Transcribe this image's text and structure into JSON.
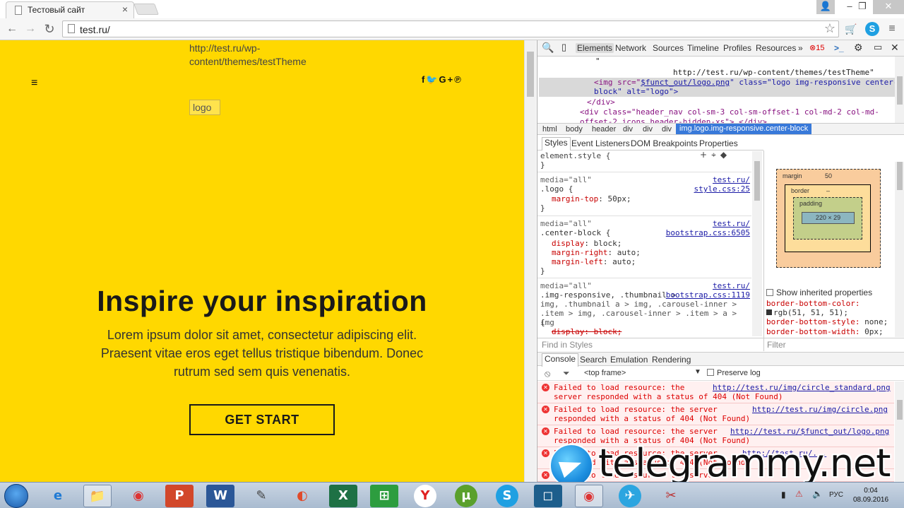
{
  "browser": {
    "tab_title": "Тестовый сайт",
    "tab_close": "×",
    "address": "test.ru/",
    "window_controls": {
      "minimize": "–",
      "maximize": "❐",
      "close": "✕"
    },
    "user_badge": "👤"
  },
  "page": {
    "theme_url": "http://test.ru/wp-content/themes/testTheme",
    "menu_icon": "≡",
    "social": "f🐦 G+ ℗",
    "logo_alt": "logo",
    "hero_title": "Inspire your inspiration",
    "hero_text": "Lorem ipsum dolor sit amet, consectetur adipiscing elit. Praesent vitae eros eget tellus tristique bibendum. Donec rutrum sed sem quis venenatis.",
    "hero_button": "GET START",
    "background_color": "#ffd800"
  },
  "devtools": {
    "tabs": [
      "Elements",
      "Network",
      "Sources",
      "Timeline",
      "Profiles",
      "Resources"
    ],
    "more": "»",
    "error_count": "15",
    "dom_lines": {
      "quote": "\"",
      "theme_text": "http://test.ru/wp-content/themes/testTheme\"",
      "img_open": "<img src=\"",
      "img_src": "$funct_out/logo.png",
      "img_rest": "\" class=\"logo img-responsive center-",
      "img_rest2": "block\" alt=\"logo\">",
      "div_close": "</div>",
      "div_next": "<div class=\"header_nav col-sm-3 col-sm-offset-1 col-md-2 col-md-",
      "div_next2": "offset-2 icons header-hidden-xs\">…</div>"
    },
    "breadcrumbs": [
      "html",
      "body",
      "header",
      "div",
      "div",
      "div",
      "img.logo.img-responsive.center-block"
    ],
    "styles_tabs": [
      "Styles",
      "Event Listeners",
      "DOM Breakpoints",
      "Properties"
    ],
    "rules": {
      "element_style": "element.style {",
      "close": "}",
      "media": "media=\"all\"",
      "r1_src_a": "test.ru/",
      "r1_src_b": "style.css:25",
      "r1_sel": ".logo {",
      "r1_p1": "margin-top",
      "r1_v1": ": 50px;",
      "r2_src_a": "test.ru/",
      "r2_src_b": "bootstrap.css:6505",
      "r2_sel": ".center-block {",
      "r2_p1": "display",
      "r2_v1": ": block;",
      "r2_p2": "margin-right",
      "r2_v2": ": auto;",
      "r2_p3": "margin-left",
      "r2_v3": ": auto;",
      "r3_src_a": "test.ru/",
      "r3_src_b": "bootstrap.css:1119",
      "r3_sel1": ".img-responsive, .thumbnail >",
      "r3_sel2": "img, .thumbnail a > img, .carousel-inner >",
      "r3_sel3": ".item > img, .carousel-inner > .item > a > img",
      "r3_brace": "{",
      "r3_p1": "display: block;"
    },
    "find_styles": "Find in Styles",
    "filter": "Filter",
    "boxmodel": {
      "margin_label": "margin",
      "margin_val": "50",
      "border_label": "border",
      "padding_label": "padding",
      "content": "220 × 29",
      "dash": "–"
    },
    "show_inherited": "Show inherited properties",
    "computed": [
      {
        "prop": "border-bottom-color:",
        "val": ""
      },
      {
        "prop": "",
        "val": "rgb(51, 51, 51);"
      },
      {
        "prop": "border-bottom-style:",
        "val": "none;"
      },
      {
        "prop": "border-bottom-width:",
        "val": "0px;"
      }
    ],
    "console_tabs": [
      "Console",
      "Search",
      "Emulation",
      "Rendering"
    ],
    "frame": "<top frame>",
    "preserve_log": "Preserve log",
    "errors": [
      {
        "msg": "Failed to load resource: the\nserver responded with a status of 404 (Not Found)",
        "url": "http://test.ru/img/circle_standard.png"
      },
      {
        "msg": "Failed to load resource: the server\nresponded with a status of 404 (Not Found)",
        "url": "http://test.ru/img/circle.png"
      },
      {
        "msg": "Failed to load resource: the server\nresponded with a status of 404 (Not Found)",
        "url": "http://test.ru/$funct_out/logo.png"
      },
      {
        "msg": "Failed to load resource: the server\nresponded with a status of 404 (Not Found)",
        "url": "http://test.ru/..."
      },
      {
        "msg": "Failed to load resource: the server",
        "url": ""
      }
    ]
  },
  "watermark": {
    "text": "telegrammy.net"
  },
  "taskbar": {
    "items": [
      "e",
      "📁",
      "◉",
      "P",
      "W",
      "✎",
      "◐",
      "X",
      "⊞",
      "Y",
      "µ",
      "S",
      "◻",
      "◉",
      "✈",
      "✂"
    ],
    "lang": "РУС",
    "time": "0:04",
    "date": "08.09.2016"
  }
}
